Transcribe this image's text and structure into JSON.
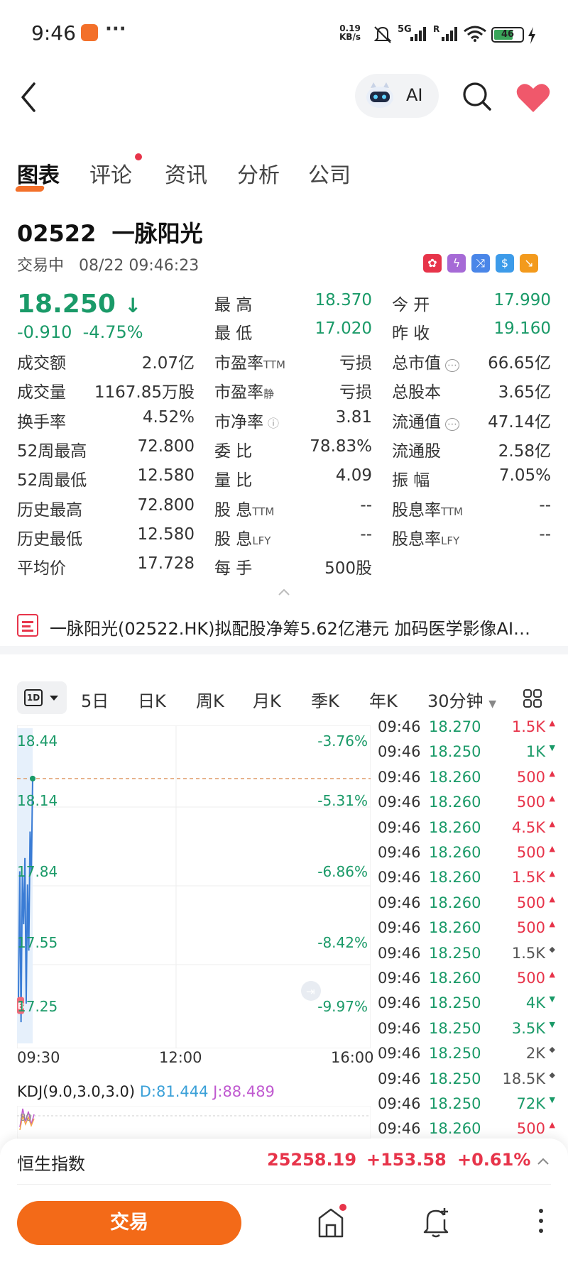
{
  "status_bar": {
    "time": "9:46",
    "more": "···",
    "net_speed_top": "0.19",
    "net_speed_bottom": "KB/s",
    "signal1": "5G",
    "signal2": "R",
    "battery": "46"
  },
  "header": {
    "ai_label": "AI"
  },
  "tabs": [
    {
      "label": "图表",
      "active": true
    },
    {
      "label": "评论",
      "badge": true
    },
    {
      "label": "资讯"
    },
    {
      "label": "分析"
    },
    {
      "label": "公司"
    }
  ],
  "stock": {
    "code": "02522",
    "name": "一脉阳光",
    "status": "交易中",
    "datetime": "08/22 09:46:23",
    "price": "18.250",
    "arrow": "↓",
    "change": "-0.910",
    "change_pct": "-4.75%",
    "market_icons": [
      "hk-flag-icon",
      "lightning-icon",
      "shuffle-icon",
      "dollar-icon",
      "trend-down-icon"
    ]
  },
  "quote_rows": [
    [
      "最 高",
      "18.370",
      "今 开",
      "17.990"
    ],
    [
      "最 低",
      "17.020",
      "昨 收",
      "19.160"
    ]
  ],
  "quote_grid": [
    {
      "l1": "成交额",
      "v1": "2.07亿",
      "l2": "市盈率",
      "s2": "TTM",
      "v2": "亏损",
      "l3": "总市值",
      "s3": "",
      "info3": true,
      "v3": "66.65亿"
    },
    {
      "l1": "成交量",
      "v1": "1167.85万股",
      "l2": "市盈率",
      "s2": "静",
      "v2": "亏损",
      "l3": "总股本",
      "s3": "",
      "v3": "3.65亿"
    },
    {
      "l1": "换手率",
      "v1": "4.52%",
      "l2": "市净率",
      "s2": "",
      "info2": true,
      "v2": "3.81",
      "l3": "流通值",
      "s3": "",
      "info3": true,
      "v3": "47.14亿"
    },
    {
      "l1": "52周最高",
      "v1": "72.800",
      "l2": "委 比",
      "s2": "",
      "v2": "78.83%",
      "l3": "流通股",
      "s3": "",
      "v3": "2.58亿"
    },
    {
      "l1": "52周最低",
      "v1": "12.580",
      "l2": "量 比",
      "s2": "",
      "v2": "4.09",
      "l3": "振 幅",
      "s3": "",
      "v3": "7.05%"
    },
    {
      "l1": "历史最高",
      "v1": "72.800",
      "l2": "股 息",
      "s2": "TTM",
      "v2": "--",
      "l3": "股息率",
      "s3": "TTM",
      "v3": "--"
    },
    {
      "l1": "历史最低",
      "v1": "12.580",
      "l2": "股 息",
      "s2": "LFY",
      "v2": "--",
      "l3": "股息率",
      "s3": "LFY",
      "v3": "--"
    },
    {
      "l1": "平均价",
      "v1": "17.728",
      "l2": "每 手",
      "s2": "",
      "v2": "500股",
      "l3": "",
      "s3": "",
      "v3": ""
    }
  ],
  "news": {
    "headline": "一脉阳光(02522.HK)拟配股净筹5.62亿港元 加码医学影像AI…"
  },
  "period_tabs": {
    "selected": "1D",
    "items": [
      "5日",
      "日K",
      "周K",
      "月K",
      "季K",
      "年K"
    ],
    "interval": "30分钟"
  },
  "chart_data": {
    "type": "line",
    "y_ticks": [
      "18.44",
      "18.14",
      "17.84",
      "17.55",
      "17.25"
    ],
    "pct_ticks": [
      "-3.76%",
      "-5.31%",
      "-6.86%",
      "-8.42%",
      "-9.97%"
    ],
    "x_ticks": [
      "09:30",
      "12:00",
      "16:00"
    ],
    "ylim": [
      17.25,
      18.44
    ],
    "prev_close_line": 18.25,
    "marker": "B",
    "series": [
      {
        "values": [
          17.42,
          17.9,
          17.33,
          17.88,
          17.7,
          17.95,
          17.4,
          17.85,
          17.6,
          18.05,
          17.9,
          18.25
        ]
      }
    ],
    "indicator": {
      "label": "KDJ(9.0,3.0,3.0)",
      "d": "D:81.444",
      "j": "J:88.489",
      "level": "80"
    }
  },
  "trades": [
    {
      "time": "09:46",
      "price": "18.270",
      "vol": "1.5K",
      "dir": "up"
    },
    {
      "time": "09:46",
      "price": "18.250",
      "vol": "1K",
      "dir": "down"
    },
    {
      "time": "09:46",
      "price": "18.260",
      "vol": "500",
      "dir": "up"
    },
    {
      "time": "09:46",
      "price": "18.260",
      "vol": "500",
      "dir": "up"
    },
    {
      "time": "09:46",
      "price": "18.260",
      "vol": "4.5K",
      "dir": "up"
    },
    {
      "time": "09:46",
      "price": "18.260",
      "vol": "500",
      "dir": "up"
    },
    {
      "time": "09:46",
      "price": "18.260",
      "vol": "1.5K",
      "dir": "up"
    },
    {
      "time": "09:46",
      "price": "18.260",
      "vol": "500",
      "dir": "up"
    },
    {
      "time": "09:46",
      "price": "18.260",
      "vol": "500",
      "dir": "up"
    },
    {
      "time": "09:46",
      "price": "18.250",
      "vol": "1.5K",
      "dir": "neutral"
    },
    {
      "time": "09:46",
      "price": "18.260",
      "vol": "500",
      "dir": "up"
    },
    {
      "time": "09:46",
      "price": "18.250",
      "vol": "4K",
      "dir": "down"
    },
    {
      "time": "09:46",
      "price": "18.250",
      "vol": "3.5K",
      "dir": "down"
    },
    {
      "time": "09:46",
      "price": "18.250",
      "vol": "2K",
      "dir": "neutral"
    },
    {
      "time": "09:46",
      "price": "18.250",
      "vol": "18.5K",
      "dir": "neutral"
    },
    {
      "time": "09:46",
      "price": "18.250",
      "vol": "72K",
      "dir": "down"
    },
    {
      "time": "09:46",
      "price": "18.260",
      "vol": "500",
      "dir": "up"
    }
  ],
  "index_bar": {
    "name": "恒生指数",
    "value": "25258.19",
    "change": "+153.58",
    "pct": "+0.61%"
  },
  "bottom_nav": {
    "trade_label": "交易"
  },
  "colors": {
    "up": "#e7344a",
    "down": "#1a9a68",
    "accent": "#f36a18"
  }
}
